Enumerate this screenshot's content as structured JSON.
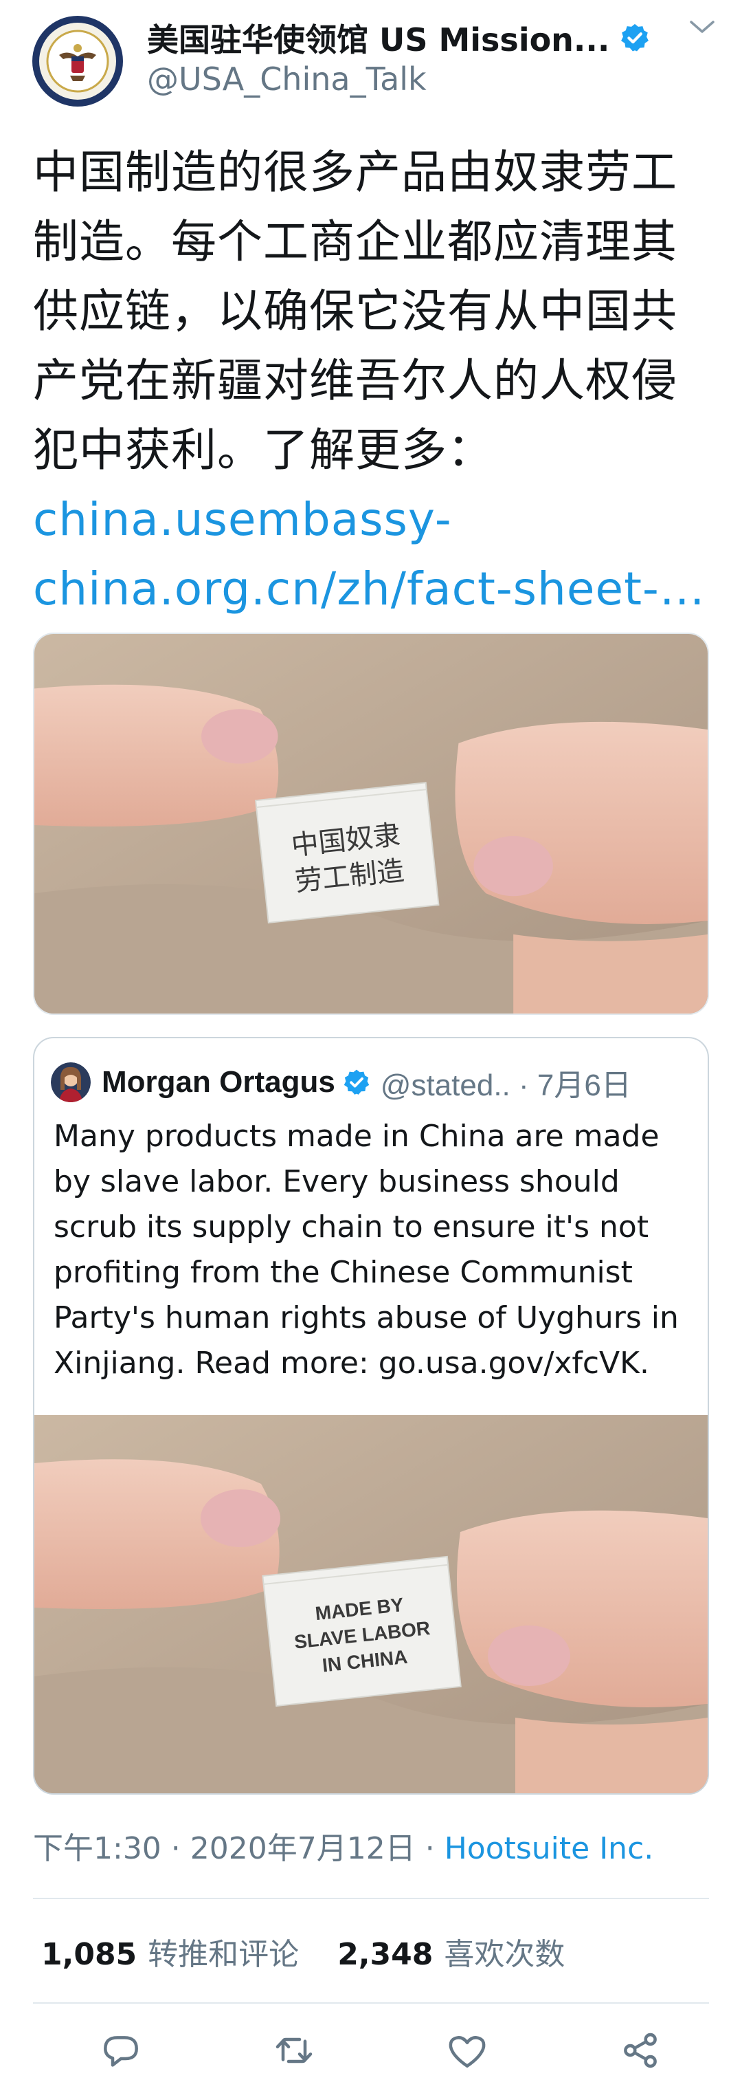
{
  "tweet": {
    "author_name": "美国驻华使领馆 US Mission...",
    "handle": "@USA_China_Talk",
    "text_main": "中国制造的很多产品由奴隶劳工制造。每个工商企业都应清理其供应链，以确保它没有从中国共产党在新疆对维吾尔人的人权侵犯中获利。了解更多：",
    "link": "china.usembassy-china.org.cn/zh/fact-sheet-…",
    "image_label_text": "中国奴隶 劳工制造",
    "time": "下午1:30 · 2020年7月12日 · ",
    "source": "Hootsuite Inc."
  },
  "quote": {
    "author_name": "Morgan Ortagus",
    "handle_date": "@stated.. · 7月6日",
    "text": "Many products made in China are made by slave labor. Every business should scrub its supply chain to ensure it's not profiting from the Chinese Communist Party's human rights abuse of Uyghurs in Xinjiang. Read more: go.usa.gov/xfcVK.",
    "image_label_lines": [
      "MADE BY",
      "SLAVE LABOR",
      "IN CHINA"
    ]
  },
  "stats": {
    "retweets_count": "1,085",
    "retweets_label": "转推和评论",
    "likes_count": "2,348",
    "likes_label": "喜欢次数"
  },
  "actions": [
    "reply-icon",
    "retweet-icon",
    "like-icon",
    "share-icon"
  ],
  "colors": {
    "link": "#1b95e0",
    "verified": "#1da1f2",
    "secondary_text": "#657786",
    "icon": "#657786"
  }
}
